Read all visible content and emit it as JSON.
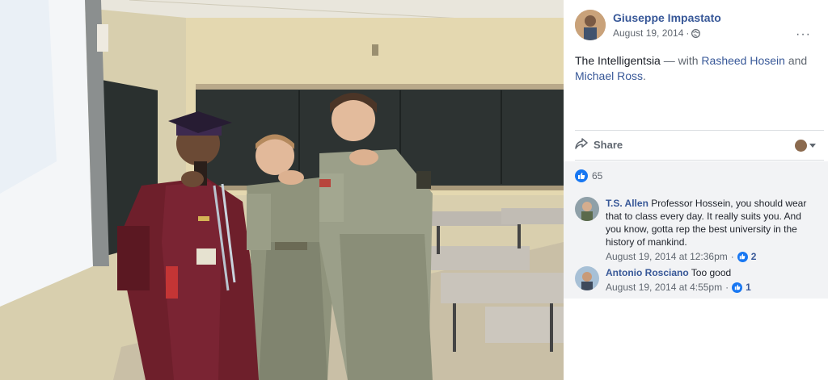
{
  "post": {
    "author": "Giuseppe Impastato",
    "date": "August 19, 2014",
    "meta_separator": "·",
    "caption_text": "The Intelligentsia",
    "caption_with": " — with ",
    "tagged_1": "Rasheed Hosein",
    "caption_and": " and ",
    "tagged_2": "Michael Ross",
    "caption_end": ".",
    "more_label": "···",
    "share_label": "Share",
    "likes_count": "65"
  },
  "comments": [
    {
      "name": "T.S. Allen",
      "text": "Professor Hossein, you should wear that to class every day. It really suits you. And you know, gotta rep the best university in the history of mankind.",
      "timestamp": "August 19, 2014 at 12:36pm",
      "separator": "·",
      "reactions": "2"
    },
    {
      "name": "Antonio Rosciano",
      "text": "Too good",
      "timestamp": "August 19, 2014 at 4:55pm",
      "separator": "·",
      "reactions": "1"
    }
  ],
  "colors": {
    "link": "#385898",
    "like_blue": "#1877f2",
    "secondary_text": "#606770",
    "comment_bg": "#f2f3f5"
  },
  "icons": [
    "globe-icon",
    "more-icon",
    "share-icon",
    "like-icon",
    "caret-down-icon"
  ]
}
